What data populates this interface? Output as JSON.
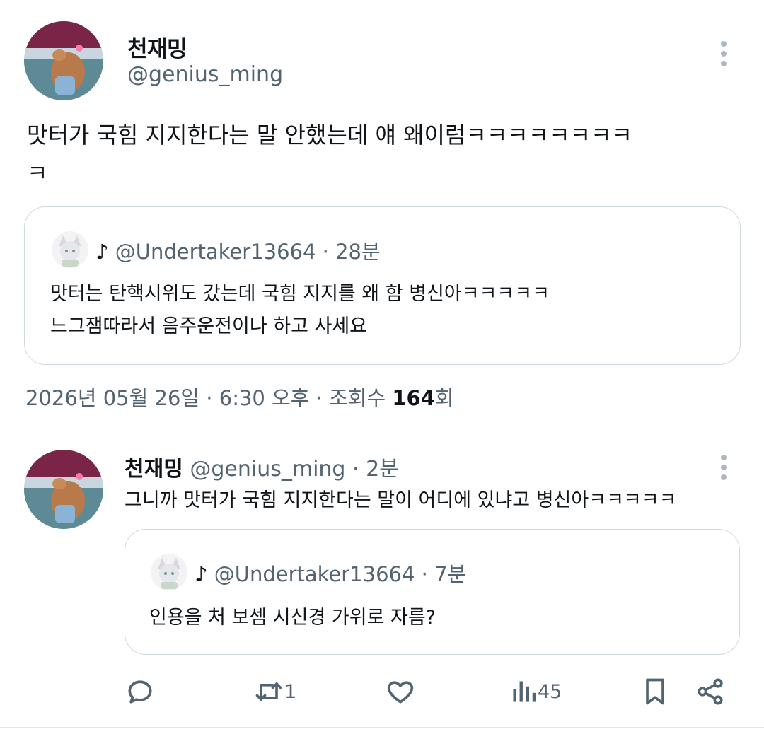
{
  "main_tweet": {
    "display_name": "천재밍",
    "handle": "@genius_ming",
    "text_line1": "맛터가 국힘 지지한다는 말 안했는데 얘 왜이럼ㅋㅋㅋㅋㅋㅋㅋㅋ",
    "text_line2": "ㅋ",
    "quote": {
      "note_icon": "♪",
      "handle": "@Undertaker13664",
      "time": "· 28분",
      "line1": "맛터는 탄핵시위도 갔는데 국힘 지지를 왜 함 병신아ㅋㅋㅋㅋㅋ",
      "line2": "느그잼따라서 음주운전이나 하고 사세요"
    },
    "meta_prefix": "2026년 05월 26일 · 6:30 오후 · 조회수 ",
    "views": "164",
    "meta_suffix": "회"
  },
  "reply": {
    "display_name": "천재밍",
    "handle": "@genius_ming",
    "time": "· 2분",
    "text": "그니까 맛터가 국힘 지지한다는 말이 어디에 있냐고 병신아ㅋㅋㅋㅋㅋ",
    "quote": {
      "note_icon": "♪",
      "handle": "@Undertaker13664",
      "time": "· 7분",
      "text": "인용을 처 보셈 시신경 가위로 자름?"
    },
    "actions": {
      "retweet_count": "1",
      "views_count": "45"
    }
  },
  "icons": {
    "more": "more-vertical-icon",
    "reply": "reply-icon",
    "retweet": "retweet-icon",
    "like": "heart-icon",
    "views": "views-icon",
    "bookmark": "bookmark-icon",
    "share": "share-icon"
  },
  "colors": {
    "text_primary": "#0f1419",
    "text_secondary": "#536471",
    "border": "#cfd9de"
  }
}
